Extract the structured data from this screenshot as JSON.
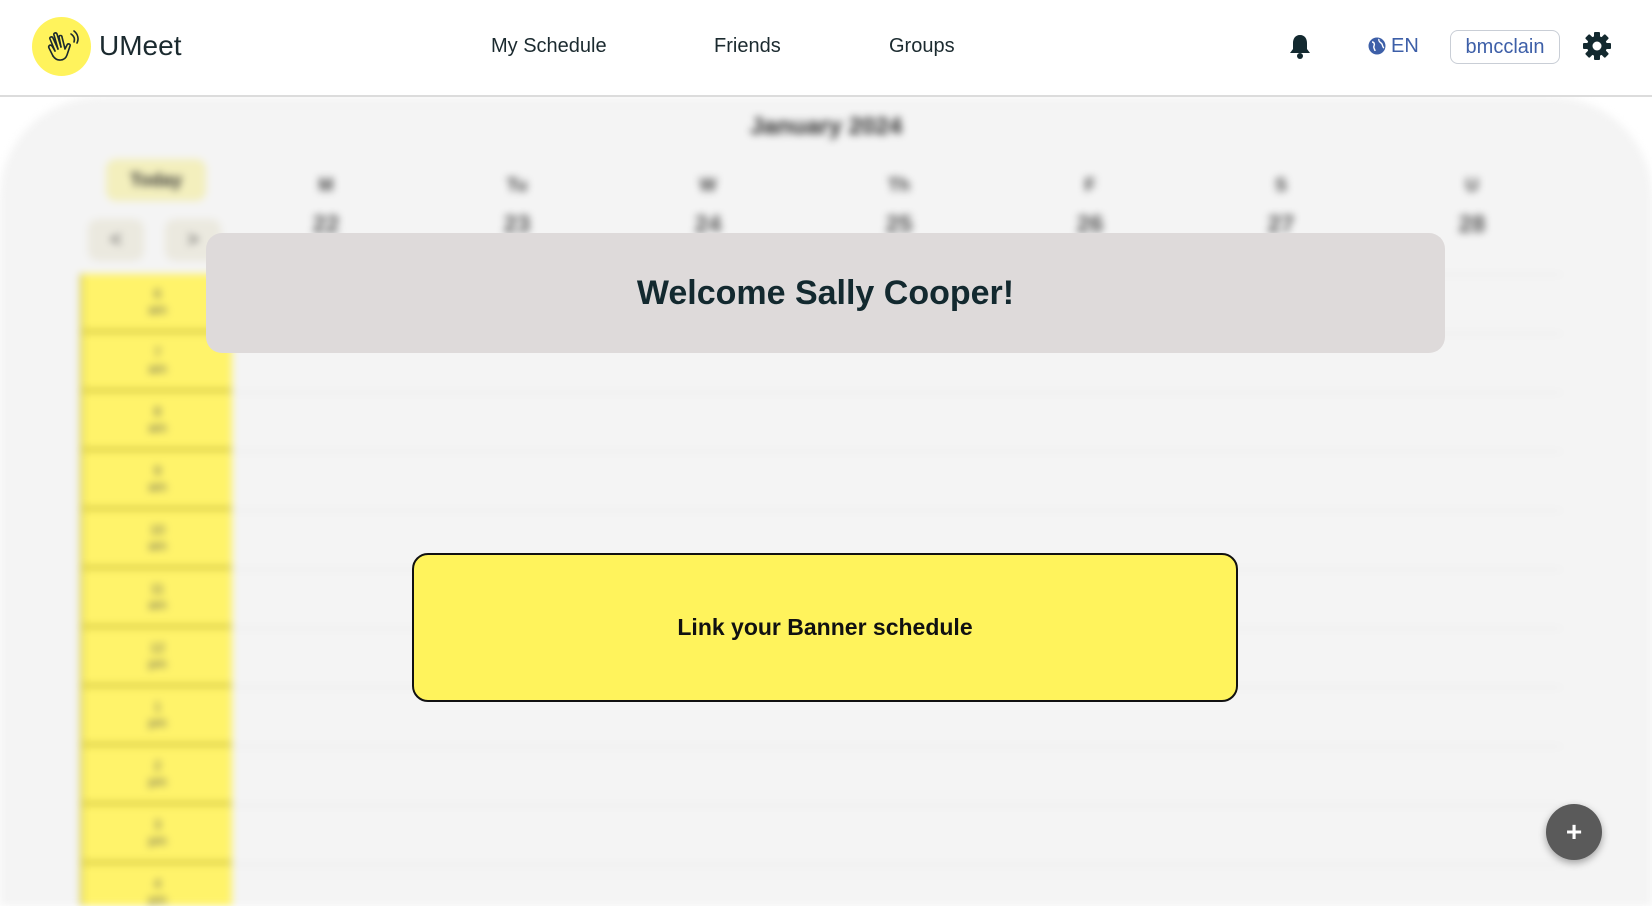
{
  "app": {
    "brand": "UMeet"
  },
  "nav": {
    "items": [
      {
        "label": "My Schedule"
      },
      {
        "label": "Friends"
      },
      {
        "label": "Groups"
      }
    ]
  },
  "header_right": {
    "language": "EN",
    "username": "bmcclain",
    "icons": [
      "bell-icon",
      "globe-icon",
      "gear-icon"
    ]
  },
  "calendar": {
    "month_title": "January 2024",
    "today_label": "Today",
    "prev_label": "<",
    "next_label": ">",
    "days": [
      {
        "abbr": "M",
        "num": "22"
      },
      {
        "abbr": "Tu",
        "num": "23"
      },
      {
        "abbr": "W",
        "num": "24"
      },
      {
        "abbr": "Th",
        "num": "25"
      },
      {
        "abbr": "F",
        "num": "26"
      },
      {
        "abbr": "S",
        "num": "27"
      },
      {
        "abbr": "U",
        "num": "28"
      }
    ],
    "times": [
      {
        "hour": "6",
        "period": "am"
      },
      {
        "hour": "7",
        "period": "am"
      },
      {
        "hour": "8",
        "period": "am"
      },
      {
        "hour": "9",
        "period": "am"
      },
      {
        "hour": "10",
        "period": "am"
      },
      {
        "hour": "11",
        "period": "am"
      },
      {
        "hour": "12",
        "period": "pm"
      },
      {
        "hour": "1",
        "period": "pm"
      },
      {
        "hour": "2",
        "period": "pm"
      },
      {
        "hour": "3",
        "period": "pm"
      },
      {
        "hour": "4",
        "period": "pm"
      }
    ]
  },
  "welcome": {
    "message": "Welcome Sally Cooper!"
  },
  "banner": {
    "link_label": "Link your Banner schedule"
  },
  "fab": {
    "label": "+"
  },
  "colors": {
    "accent_yellow": "#fff35c",
    "text_dark": "#13292f",
    "link_blue": "#3d5fa8",
    "welcome_bg": "#dedada",
    "fab_bg": "#5a5a5a"
  }
}
